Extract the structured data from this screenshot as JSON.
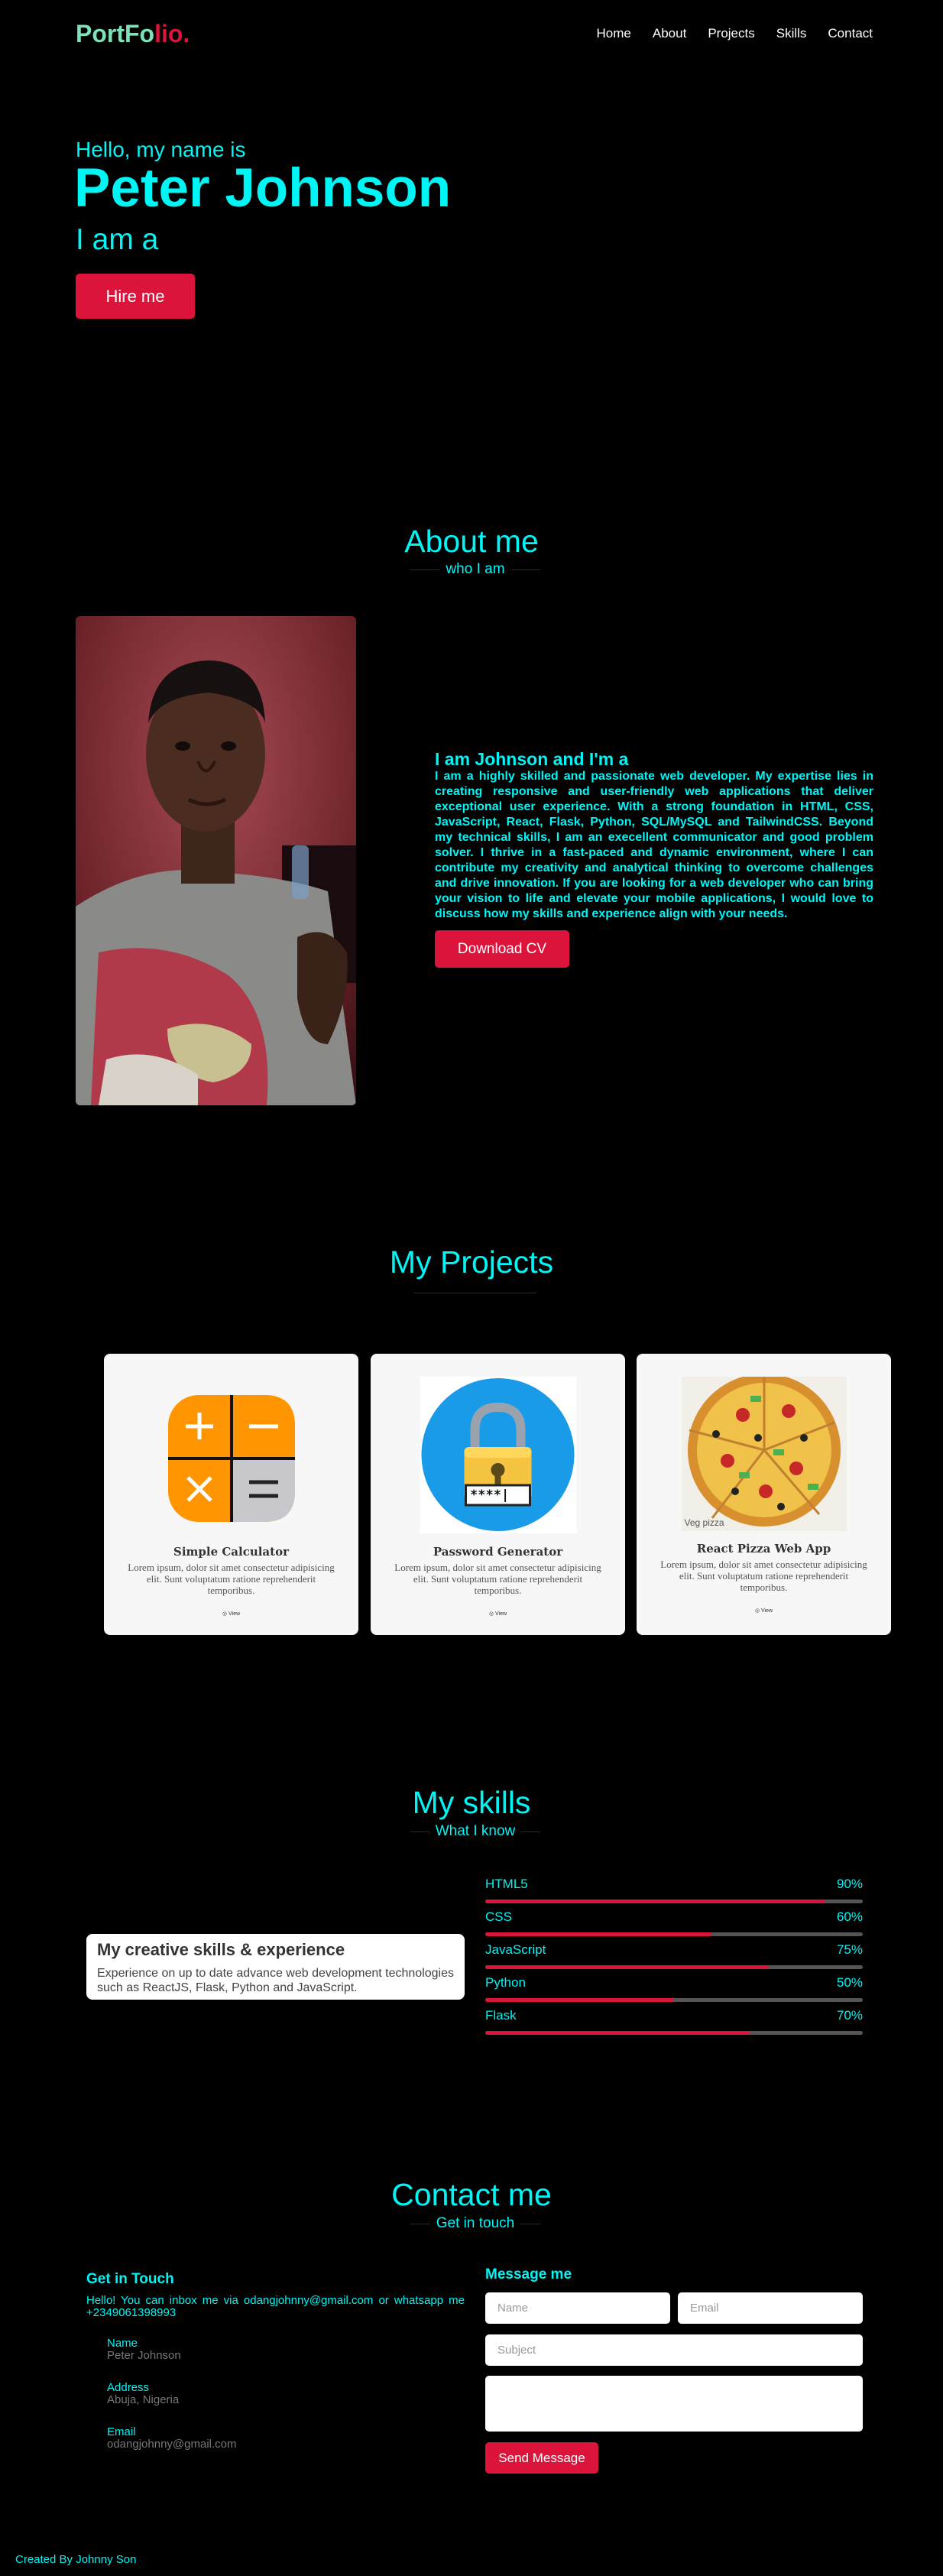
{
  "nav": {
    "logo_part1": "PortFo",
    "logo_part2": "lio.",
    "links": [
      "Home",
      "About",
      "Projects",
      "Skills",
      "Contact"
    ]
  },
  "hero": {
    "greeting": "Hello, my name is",
    "name": "Peter Johnson",
    "subtitle": "I am a",
    "button": "Hire me"
  },
  "about": {
    "title": "About me",
    "subtitle": "who I am",
    "heading": "I am Johnson and I'm a",
    "text": "I am a highly skilled and passionate web developer. My expertise lies in creating responsive and user-friendly web applications that deliver exceptional user experience. With a strong foundation in HTML, CSS, JavaScript, React, Flask, Python, SQL/MySQL and TailwindCSS. Beyond my technical skills, I am an execellent communicator and good problem solver. I thrive in a fast-paced and dynamic environment, where I can contribute my creativity and analytical thinking to overcome challenges and drive innovation. If you are looking for a web developer who can bring your vision to life and elevate your mobile applications, I would love to discuss how my skills and experience align with your needs.",
    "button": "Download CV"
  },
  "projects": {
    "title": "My Projects",
    "items": [
      {
        "title": "Simple Calculator",
        "desc": "Lorem ipsum, dolor sit amet consectetur adipisicing elit. Sunt voluptatum ratione reprehenderit temporibus.",
        "link": "View",
        "icon": "calculator-icon"
      },
      {
        "title": "Password Generator",
        "desc": "Lorem ipsum, dolor sit amet consectetur adipisicing elit. Sunt voluptatum ratione reprehenderit temporibus.",
        "link": "View",
        "icon": "padlock-icon",
        "mask": "****|"
      },
      {
        "title": "React Pizza Web App",
        "desc": "Lorem ipsum, dolor sit amet consectetur adipisicing elit. Sunt voluptatum ratione reprehenderit temporibus.",
        "link": "View",
        "icon": "pizza-icon",
        "img_caption": "Veg pizza"
      }
    ]
  },
  "skills": {
    "title": "My skills",
    "subtitle": "What I know",
    "card_title": "My creative skills & experience",
    "card_text": "Experience on up to date advance web development technologies such as ReactJS, Flask, Python and JavaScript.",
    "items": [
      {
        "name": "HTML5",
        "label": "90%",
        "value": 0.9
      },
      {
        "name": "CSS",
        "label": "60%",
        "value": 0.6
      },
      {
        "name": "JavaScript",
        "label": "75%",
        "value": 0.75
      },
      {
        "name": "Python",
        "label": "50%",
        "value": 0.5
      },
      {
        "name": "Flask",
        "label": "70%",
        "value": 0.7
      }
    ]
  },
  "contact": {
    "title": "Contact me",
    "subtitle": "Get in touch",
    "git_heading": "Get in Touch",
    "git_text": "Hello! You can inbox me via odangjohnny@gmail.com or whatsapp me +2349061398993",
    "name_label": "Name",
    "name_value": "Peter Johnson",
    "address_label": "Address",
    "address_value": "Abuja, Nigeria",
    "email_label": "Email",
    "email_value": "odangjohnny@gmail.com",
    "msg_heading": "Message me",
    "name_placeholder": "Name",
    "email_placeholder": "Email",
    "subject_placeholder": "Subject",
    "send_button": "Send Message"
  },
  "footer": {
    "text": "Created By Johnny Son"
  },
  "colors": {
    "accent": "#00f5f5",
    "brand_red": "#dc143c",
    "logo_green": "#7ee2b8"
  }
}
